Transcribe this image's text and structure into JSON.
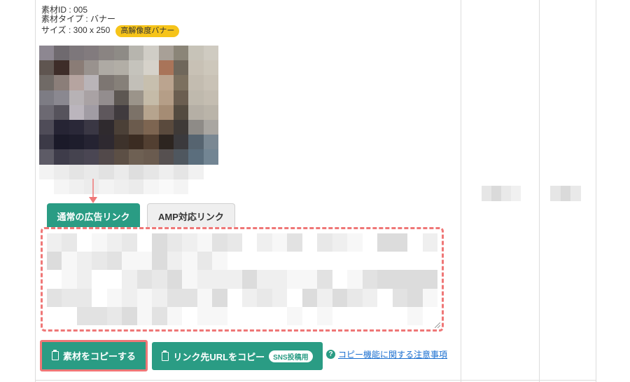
{
  "material": {
    "id_line": "素材ID : 005",
    "type_line": "素材タイプ : バナー",
    "size_line": "サイズ : 300 x 250",
    "badge": "高解像度バナー"
  },
  "tabs": {
    "normal": "通常の広告リンク",
    "amp": "AMP対応リンク"
  },
  "buttons": {
    "copy_material": "素材をコピーする",
    "copy_url": "リンク先URLをコピー",
    "sns_badge": "SNS投稿用"
  },
  "note": {
    "link": "コピー機能に関する注意事項",
    "icon": "?"
  },
  "colors": {
    "accent": "#2a9c84",
    "highlight": "#ef7777",
    "badge": "#f6c41a",
    "link": "#1a6fd0"
  }
}
